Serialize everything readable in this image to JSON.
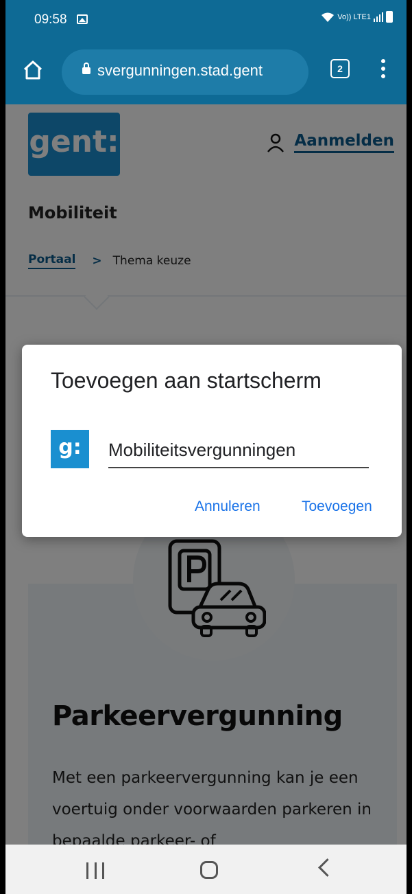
{
  "status_bar": {
    "time": "09:58",
    "network": "Vo)) LTE1"
  },
  "browser": {
    "url": "svergunningen.stad.gent",
    "tab_count": "2"
  },
  "page": {
    "logo_text": "gent:",
    "login_label": "Aanmelden",
    "section_title": "Mobiliteit",
    "breadcrumb": {
      "home": "Portaal",
      "separator": ">",
      "current": "Thema keuze"
    },
    "card": {
      "title": "Parkeervergunning",
      "body": "Met een parkeervergunning kan je een voertuig onder voorwaarden parkeren in bepaalde parkeer- of"
    }
  },
  "dialog": {
    "title": "Toevoegen aan startscherm",
    "app_icon_text": "g:",
    "name_value": "Mobiliteitsvergunningen",
    "cancel_label": "Annuleren",
    "confirm_label": "Toevoegen",
    "accent_color": "#1a73e8"
  },
  "colors": {
    "brand": "#1a8fd0",
    "toolbar": "#0e6a95",
    "link": "#0a5a8d"
  }
}
